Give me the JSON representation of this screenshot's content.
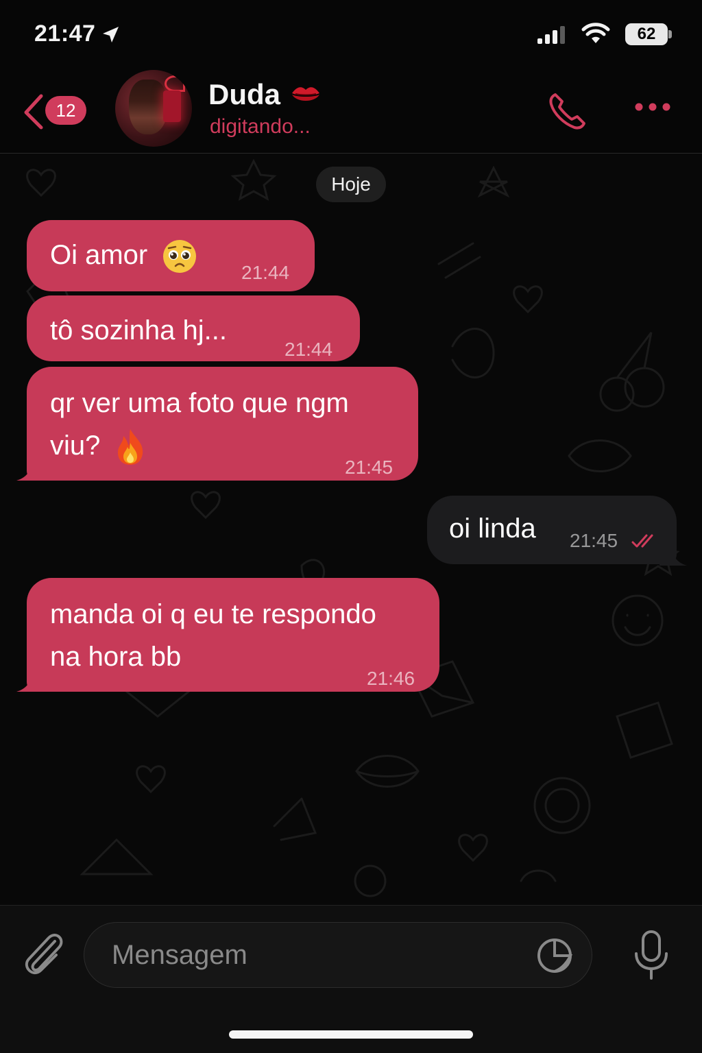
{
  "status_bar": {
    "time": "21:47",
    "battery": "62",
    "icons": [
      "location-arrow-icon",
      "cellular-signal-icon",
      "wifi-icon",
      "battery-icon"
    ]
  },
  "header": {
    "unread_count": "12",
    "contact_name": "Duda",
    "name_emoji": "kiss-mark-icon",
    "status": "digitando...",
    "accent": "#d03c5c"
  },
  "chat": {
    "date_label": "Hoje",
    "messages": [
      {
        "direction": "incoming",
        "text": "Oi amor",
        "emoji": "pleading-face",
        "time": "21:44"
      },
      {
        "direction": "incoming",
        "text": "tô sozinha hj...",
        "time": "21:44"
      },
      {
        "direction": "incoming",
        "text_line1": "qr ver uma foto que ngm",
        "text_line2": "viu?",
        "emoji": "fire",
        "time": "21:45"
      },
      {
        "direction": "outgoing",
        "text": "oi linda",
        "time": "21:45",
        "read": true
      },
      {
        "direction": "incoming",
        "text_line1": "manda oi q eu te respondo",
        "text_line2": "na hora bb",
        "time": "21:46"
      }
    ],
    "incoming_bubble_color": "#c73a58",
    "outgoing_bubble_color": "#1c1c1e"
  },
  "composer": {
    "placeholder": "Mensagem",
    "value": ""
  }
}
